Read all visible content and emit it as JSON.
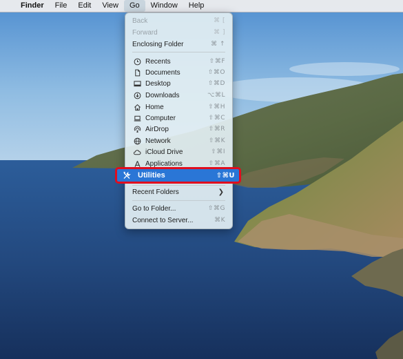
{
  "menubar": {
    "apple_icon": "apple-icon",
    "items": [
      "Finder",
      "File",
      "Edit",
      "View",
      "Go",
      "Window",
      "Help"
    ],
    "active": "Go"
  },
  "go_menu": {
    "back": {
      "label": "Back",
      "shortcut": "⌘ ["
    },
    "forward": {
      "label": "Forward",
      "shortcut": "⌘ ]"
    },
    "enclosing": {
      "label": "Enclosing Folder",
      "shortcut": "⌘ ↑"
    },
    "places": [
      {
        "label": "Recents",
        "shortcut": "⇧⌘F",
        "icon": "clock-icon"
      },
      {
        "label": "Documents",
        "shortcut": "⇧⌘O",
        "icon": "document-icon"
      },
      {
        "label": "Desktop",
        "shortcut": "⇧⌘D",
        "icon": "desktop-icon"
      },
      {
        "label": "Downloads",
        "shortcut": "⌥⌘L",
        "icon": "download-icon"
      },
      {
        "label": "Home",
        "shortcut": "⇧⌘H",
        "icon": "home-icon"
      },
      {
        "label": "Computer",
        "shortcut": "⇧⌘C",
        "icon": "computer-icon"
      },
      {
        "label": "AirDrop",
        "shortcut": "⇧⌘R",
        "icon": "airdrop-icon"
      },
      {
        "label": "Network",
        "shortcut": "⇧⌘K",
        "icon": "globe-icon"
      },
      {
        "label": "iCloud Drive",
        "shortcut": "⇧⌘I",
        "icon": "cloud-icon"
      },
      {
        "label": "Applications",
        "shortcut": "⇧⌘A",
        "icon": "applications-icon"
      }
    ],
    "utilities": {
      "label": "Utilities",
      "shortcut": "⇧⌘U",
      "icon": "tools-icon"
    },
    "recent_folders": {
      "label": "Recent Folders"
    },
    "go_to_folder": {
      "label": "Go to Folder...",
      "shortcut": "⇧⌘G"
    },
    "connect_server": {
      "label": "Connect to Server...",
      "shortcut": "⌘K"
    }
  },
  "colors": {
    "highlight": "#2a76d6",
    "annotation_outline": "#e00d1e"
  }
}
